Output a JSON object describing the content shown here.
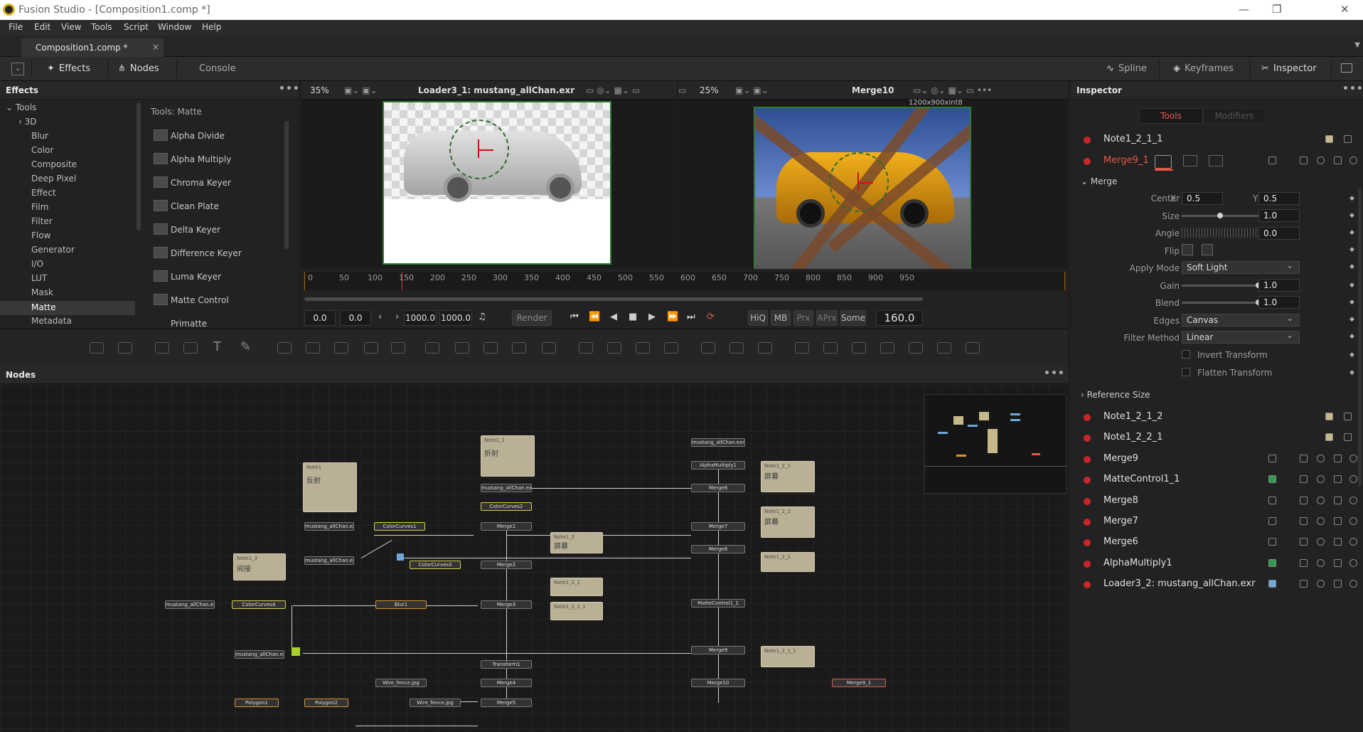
{
  "app": {
    "title": "Fusion Studio - [Composition1.comp *]"
  },
  "menu": [
    "File",
    "Edit",
    "View",
    "Tools",
    "Script",
    "Window",
    "Help"
  ],
  "doc_tab": {
    "label": "Composition1.comp *",
    "close": "×"
  },
  "toolbar": {
    "effects": "Effects",
    "nodes": "Nodes",
    "console": "Console",
    "spline": "Spline",
    "keyframes": "Keyframes",
    "inspector": "Inspector"
  },
  "effects_panel": {
    "title": "Effects",
    "tree": [
      "Tools",
      "3D",
      "Blur",
      "Color",
      "Composite",
      "Deep Pixel",
      "Effect",
      "Film",
      "Filter",
      "Flow",
      "Generator",
      "I/O",
      "LUT",
      "Mask",
      "Matte",
      "Metadata"
    ],
    "selected": "Matte",
    "tools_header": "Tools: Matte",
    "tools": [
      "Alpha Divide",
      "Alpha Multiply",
      "Chroma Keyer",
      "Clean Plate",
      "Delta Keyer",
      "Difference Keyer",
      "Luma Keyer",
      "Matte Control",
      "Primatte"
    ]
  },
  "viewer1": {
    "zoom": "35%",
    "label": "Loader3_1: mustang_allChan.exr"
  },
  "viewer2": {
    "zoom": "25%",
    "label": "Merge10",
    "res": "1200x900xint8"
  },
  "timeline": {
    "ticks": [
      "0",
      "50",
      "100",
      "150",
      "200",
      "250",
      "300",
      "350",
      "400",
      "450",
      "500",
      "550",
      "600",
      "650",
      "700",
      "750",
      "800",
      "850",
      "900",
      "950"
    ],
    "start": "0.0",
    "render_start": "0.0",
    "render_end": "1000.0",
    "end": "1000.0",
    "render_btn": "Render",
    "hiq": "HiQ",
    "mb": "MB",
    "prx": "Prx",
    "aprx": "APrx",
    "some": "Some",
    "current": "160.0"
  },
  "nodes_panel": {
    "title": "Nodes",
    "nodes": {
      "loader_top": "mustang_allChan.exr",
      "alphamultiply": "AlphaMultiply1",
      "merge6": "Merge6",
      "loader_mid": "mustang_allChan.exr",
      "colorcurves2": "ColorCurves2",
      "merge1": "Merge1",
      "loader_a": "mustang_allChan.exr",
      "colorcurves1": "ColorCurves1",
      "merge7": "Merge7",
      "merge8": "Merge8",
      "loader_b": "mustang_allChan.exr",
      "colorcurves3": "ColorCurves3",
      "merge2": "Merge2",
      "loader_c": "mustang_allChan.exr",
      "colorcurves4": "ColorCurves4",
      "blur1": "Blur1",
      "merge3": "Merge3",
      "mattecontrol": "MatteControl1_1",
      "loader_d": "mustang_allChan.exr",
      "merge9": "Merge9",
      "transform1": "Transform1",
      "wire1": "Wire_fence.jpg",
      "merge4": "Merge4",
      "merge10": "Merge10",
      "merge9_1": "Merge9_1",
      "polygon1": "Polygon1",
      "polygon2": "Polygon2",
      "wire2": "Wire_fence.jpg",
      "merge5": "Merge5"
    },
    "notes": {
      "note1": {
        "title": "Note1",
        "body": "反射"
      },
      "note1_1": {
        "title": "Note1_1",
        "body": "折射"
      },
      "note1_3": {
        "title": "Note1_3",
        "body": "间接"
      },
      "note1_2": {
        "title": "Note1_2",
        "body": "屏幕"
      },
      "note1_2_1": {
        "title": "Note1_2_1",
        "body": "屏幕"
      },
      "note1_2_2": {
        "title": "Note1_2_2",
        "body": "屏幕"
      },
      "note1_2_1b": {
        "title": "Note1_2_1",
        "body": ""
      },
      "note1_2_1_1": {
        "title": "Note1_2_1_1",
        "body": ""
      },
      "note1_2_1c": {
        "title": "Note1_2_1",
        "body": ""
      },
      "note1_2_1_1b": {
        "title": "Note1_2_1_1",
        "body": ""
      }
    }
  },
  "inspector": {
    "title": "Inspector",
    "tab_tools": "Tools",
    "tab_modifiers": "Modifiers",
    "top_rows": [
      "Note1_2_1_1",
      "Merge9_1"
    ],
    "section": "Merge",
    "params": {
      "center_label": "Center",
      "x_label": "X",
      "center_x": "0.5",
      "y_label": "Y",
      "center_y": "0.5",
      "size_label": "Size",
      "size": "1.0",
      "angle_label": "Angle",
      "angle": "0.0",
      "flip_label": "Flip",
      "apply_mode_label": "Apply Mode",
      "apply_mode": "Soft Light",
      "gain_label": "Gain",
      "gain": "1.0",
      "blend_label": "Blend",
      "blend": "1.0",
      "edges_label": "Edges",
      "edges": "Canvas",
      "filter_label": "Filter Method",
      "filter": "Linear",
      "invert": "Invert Transform",
      "flatten": "Flatten Transform"
    },
    "reference_size": "Reference Size",
    "bottom_rows": [
      "Note1_2_1_2",
      "Note1_2_2_1",
      "Merge9",
      "MatteControl1_1",
      "Merge8",
      "Merge7",
      "Merge6",
      "AlphaMultiply1",
      "Loader3_2: mustang_allChan.exr"
    ],
    "accent": "#c8262a"
  },
  "colors": {
    "accent": "#e05a4a",
    "green_frame": "#2e7d32",
    "timeline_mark": "#aa6600"
  }
}
